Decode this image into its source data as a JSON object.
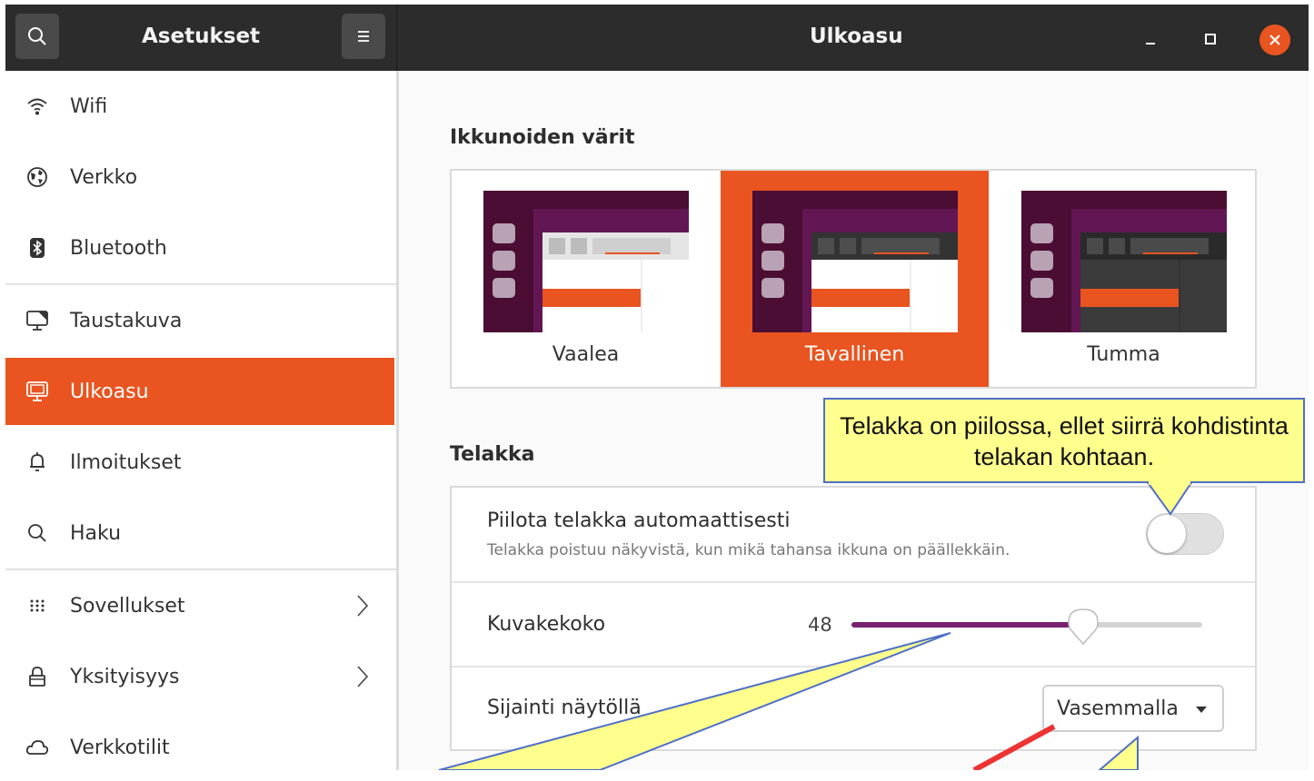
{
  "titlebar": {
    "app_title": "Asetukset",
    "page_title": "Ulkoasu"
  },
  "sidebar": {
    "items": [
      {
        "label": "Wifi",
        "icon": "wifi-icon"
      },
      {
        "label": "Verkko",
        "icon": "network-icon"
      },
      {
        "label": "Bluetooth",
        "icon": "bluetooth-icon"
      },
      {
        "label": "Taustakuva",
        "icon": "background-icon"
      },
      {
        "label": "Ulkoasu",
        "icon": "appearance-icon",
        "active": true
      },
      {
        "label": "Ilmoitukset",
        "icon": "bell-icon"
      },
      {
        "label": "Haku",
        "icon": "search-icon"
      },
      {
        "label": "Sovellukset",
        "icon": "apps-grid-icon",
        "has_chevron": true
      },
      {
        "label": "Yksityisyys",
        "icon": "lock-icon",
        "has_chevron": true
      },
      {
        "label": "Verkkotilit",
        "icon": "cloud-icon"
      }
    ]
  },
  "window_colors": {
    "heading": "Ikkunoiden värit",
    "options": [
      {
        "label": "Vaalea",
        "selected": false
      },
      {
        "label": "Tavallinen",
        "selected": true
      },
      {
        "label": "Tumma",
        "selected": false
      }
    ]
  },
  "dock": {
    "heading": "Telakka",
    "autohide": {
      "title": "Piilota telakka automaattisesti",
      "subtitle": "Telakka poistuu näkyvistä, kun mikä tahansa ikkuna on päällekkäin.",
      "enabled": false
    },
    "icon_size": {
      "label": "Kuvakekoko",
      "value": "48",
      "level": 0.66
    },
    "position": {
      "label": "Sijainti näytöllä",
      "value": "Vasemmalla"
    }
  },
  "callouts": {
    "autohide_note": "Telakka on piilossa, ellet siirrä kohdistinta telakan kohtaan."
  },
  "colors": {
    "accent": "#e95420",
    "slider_fill": "#77216f",
    "titlebar": "#2c2c2c",
    "callout_fill": "#ffff8d",
    "callout_border": "#4f6fc8",
    "arrow": "#ee3333"
  }
}
